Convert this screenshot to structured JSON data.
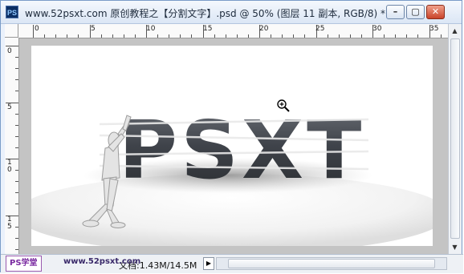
{
  "window": {
    "app_icon": "PS",
    "title": "www.52psxt.com 原创教程之【分割文字】.psd @ 50% (图层 11 副本, RGB/8) *",
    "min_label": "–",
    "max_label": "▢",
    "close_label": "✕"
  },
  "ruler_top": {
    "labels": [
      "0",
      "5",
      "10",
      "15",
      "20",
      "25",
      "30",
      "35"
    ]
  },
  "ruler_left": {
    "labels": [
      "0",
      "5",
      "10",
      "15"
    ]
  },
  "canvas": {
    "artwork_text": "PSXT"
  },
  "status": {
    "doc_size": "文档:1.43M/14.5M",
    "menu_arrow": "▶"
  },
  "watermarks": {
    "left": "PS学堂",
    "middle": "www.52psxt.com"
  },
  "colors": {
    "accent": "#7a9cc8",
    "letters": "#3c3f44"
  },
  "icons": {
    "zoom": "zoom-in-icon",
    "app": "photoshop-icon"
  }
}
